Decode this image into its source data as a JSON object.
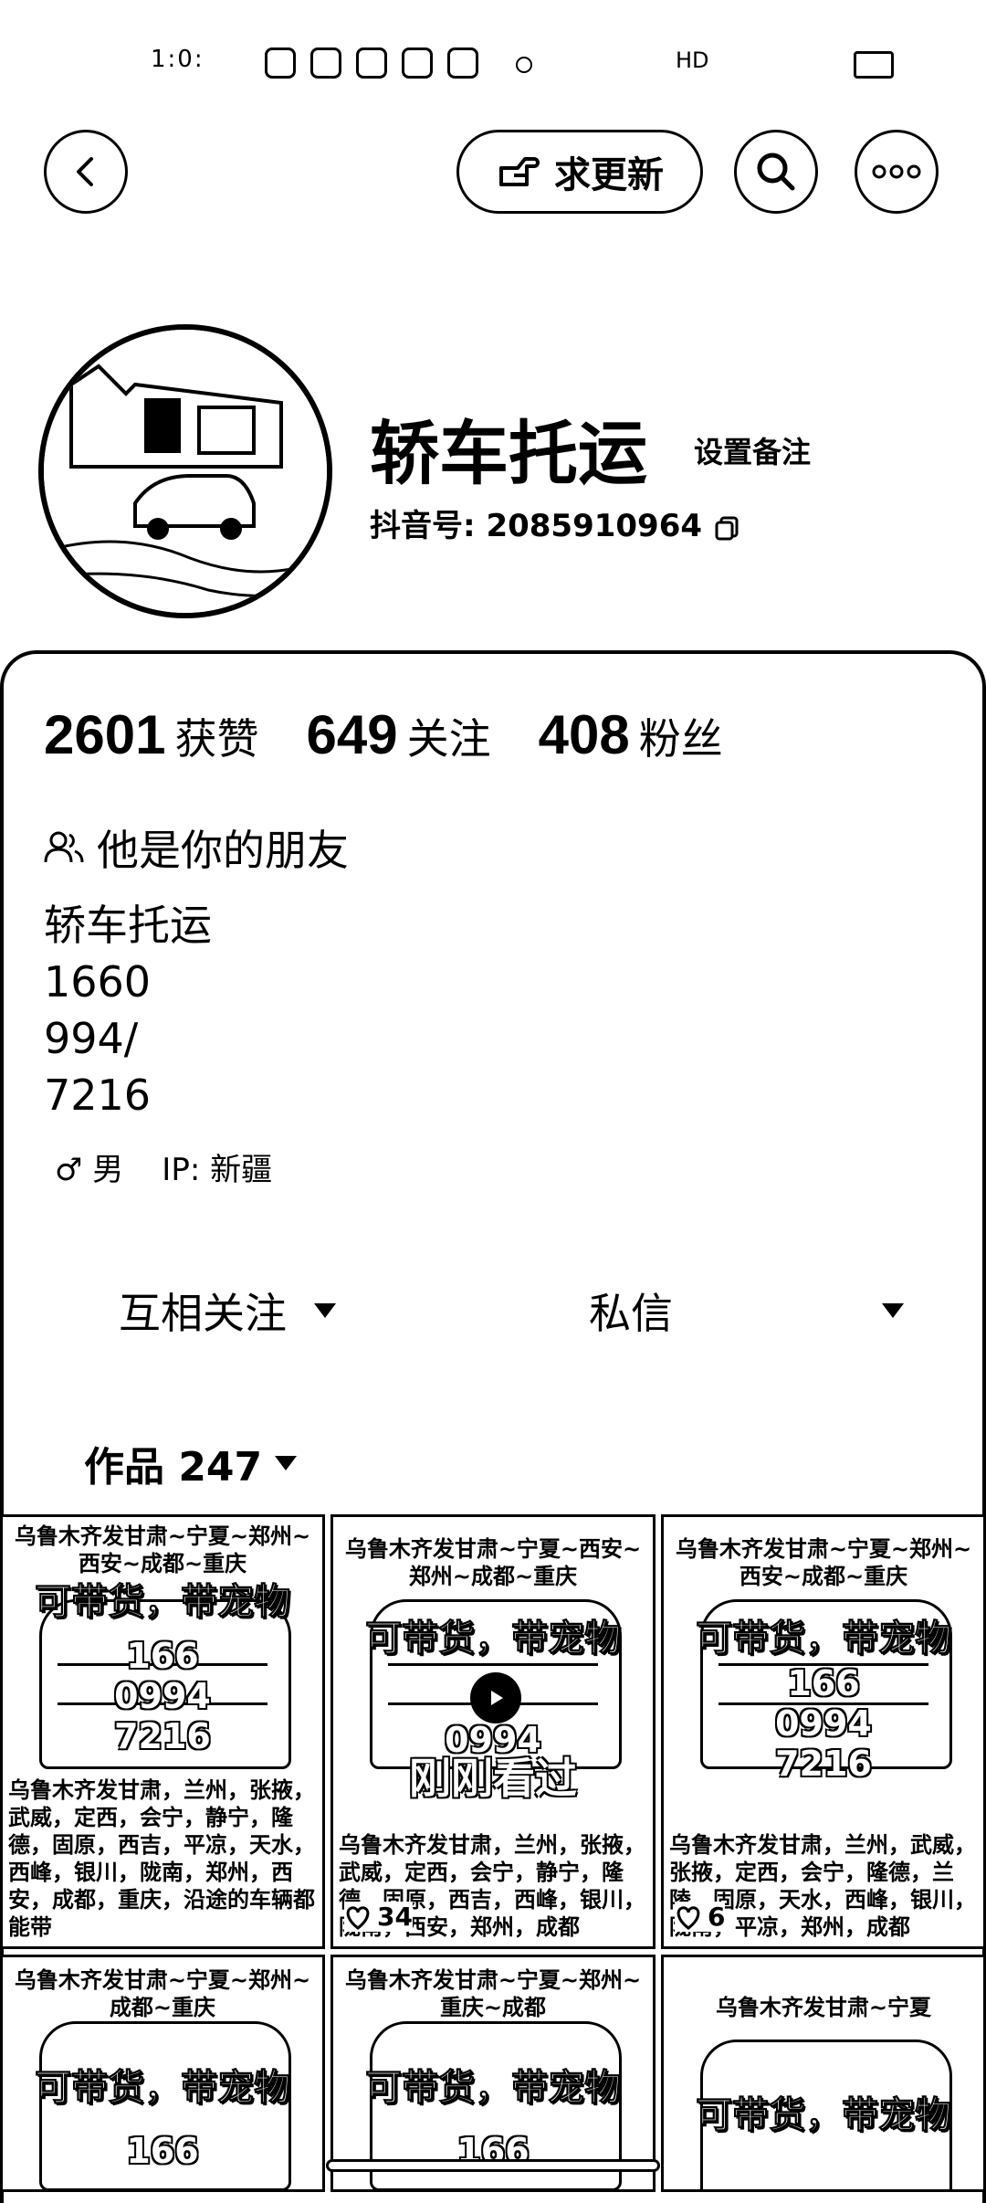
{
  "status_bar": {
    "time": "1:0:",
    "right_text": "HD"
  },
  "header": {
    "back_icon": "chevron-left-icon",
    "request_update_label": "求更新",
    "search_icon": "search-icon",
    "more_icon": "more-horizontal-icon"
  },
  "profile": {
    "name": "轿车托运",
    "set_remark_label": "设置备注",
    "douyin_id_label": "抖音号:",
    "douyin_id": "2085910964"
  },
  "stats": [
    {
      "value": "2601",
      "label": "获赞"
    },
    {
      "value": "649",
      "label": "关注"
    },
    {
      "value": "408",
      "label": "粉丝"
    }
  ],
  "friend_status": "他是你的朋友",
  "bio": {
    "line1": "轿车托运",
    "line2": "1660",
    "line3": "994/",
    "line4": "7216"
  },
  "meta": {
    "gender": "♂ 男",
    "ip": "IP: 新疆"
  },
  "actions": {
    "mutual_follow": "互相关注",
    "message": "私信"
  },
  "works_tab": {
    "label": "作品 247"
  },
  "videos": [
    {
      "top_caption": "乌鲁木齐发甘肃~宁夏~郑州~西安~成都~重庆",
      "main_caption": "可带货，带宠物",
      "phone": "166\n0994\n7216",
      "bottom_caption": "乌鲁木齐发甘肃，兰州，张掖，武威，定西，会宁，静宁，隆德，固原，西吉，平凉，天水，西峰，银川，陇南，郑州，西安，成都，重庆，沿途的车辆都能带",
      "likes": "",
      "seen": ""
    },
    {
      "top_caption": "乌鲁木齐发甘肃~宁夏~西安~郑州~成都~重庆",
      "main_caption": "可带货，带宠物",
      "phone": "0994",
      "bottom_caption": "乌鲁木齐发甘肃，兰州，张掖，武威，定西，会宁，静宁，隆德，固原，西吉，西峰，银川，陇南，西安，郑州，成都",
      "likes": "34",
      "seen": "刚刚看过"
    },
    {
      "top_caption": "乌鲁木齐发甘肃~宁夏~郑州~西安~成都~重庆",
      "main_caption": "可带货，带宠物",
      "phone": "166\n0994\n7216",
      "bottom_caption": "乌鲁木齐发甘肃，兰州，武威，张掖，定西，会宁，隆德，兰陵，固原，天水，西峰，银川，陇南，平凉，郑州，成都",
      "likes": "6",
      "seen": ""
    },
    {
      "top_caption": "乌鲁木齐发甘肃~宁夏~郑州~成都~重庆",
      "main_caption": "可带货，带宠物",
      "phone": "166",
      "bottom_caption": "",
      "likes": "",
      "seen": ""
    },
    {
      "top_caption": "乌鲁木齐发甘肃~宁夏~郑州~重庆~成都",
      "main_caption": "可带货，带宠物",
      "phone": "166",
      "bottom_caption": "",
      "likes": "",
      "seen": ""
    },
    {
      "top_caption": "乌鲁木齐发甘肃~宁夏",
      "main_caption": "可带货，带宠物",
      "phone": "",
      "bottom_caption": "",
      "likes": "",
      "seen": ""
    }
  ]
}
